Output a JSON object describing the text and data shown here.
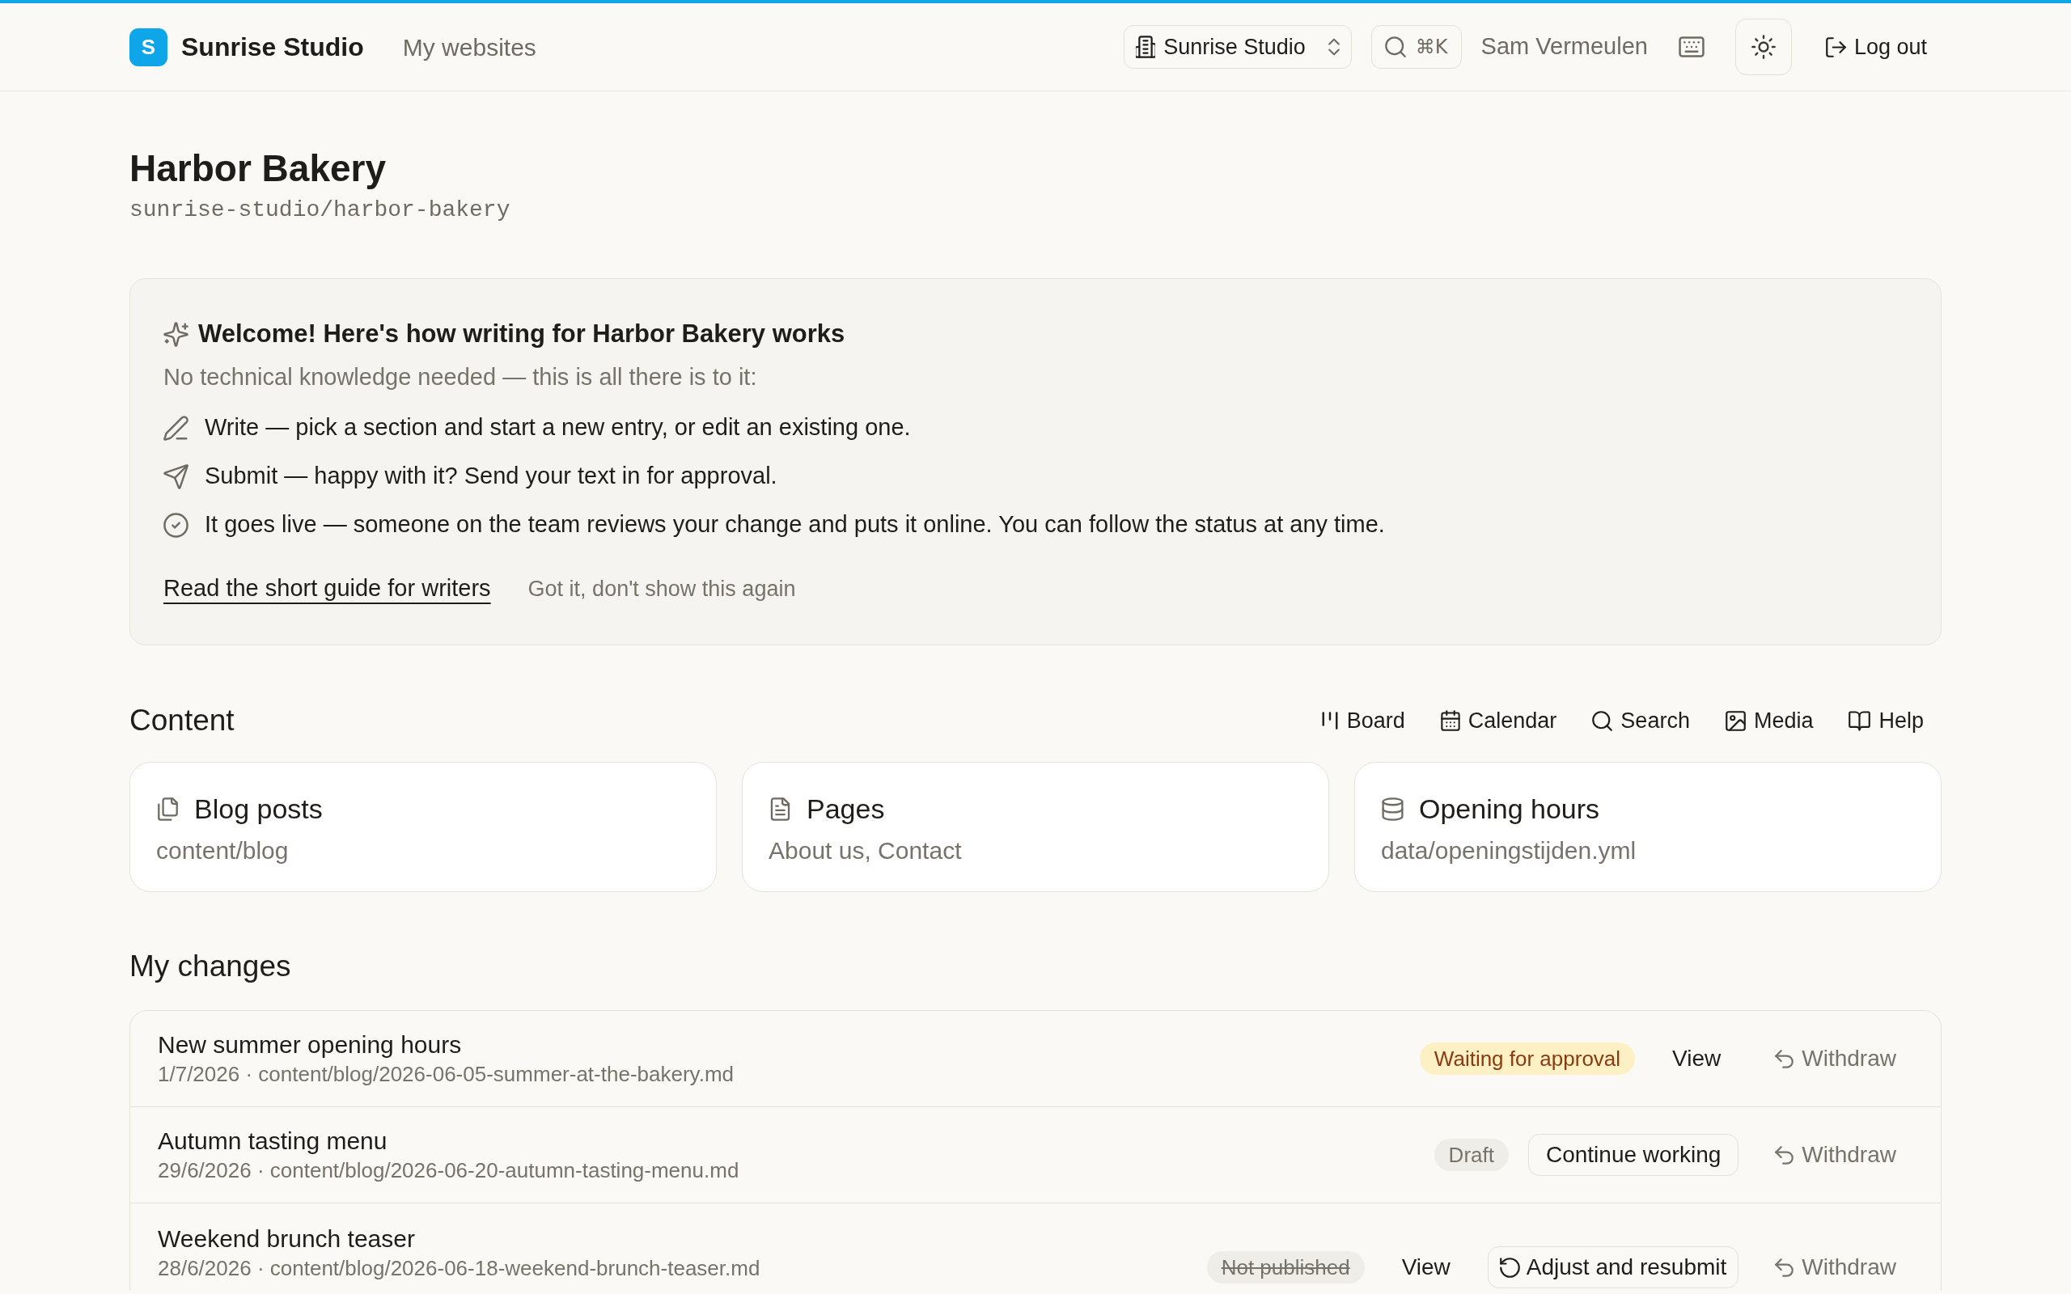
{
  "header": {
    "logo_letter": "S",
    "brand_name": "Sunrise Studio",
    "nav_link": "My websites",
    "workspace_switcher": "Sunrise Studio",
    "search_shortcut": "⌘K",
    "user_name": "Sam Vermeulen",
    "logout_label": "Log out"
  },
  "site": {
    "title": "Harbor Bakery",
    "path": "sunrise-studio/harbor-bakery"
  },
  "welcome": {
    "title": "Welcome! Here's how writing for Harbor Bakery works",
    "intro": "No technical knowledge needed — this is all there is to it:",
    "steps": [
      {
        "kind": "write",
        "text": "Write — pick a section and start a new entry, or edit an existing one."
      },
      {
        "kind": "submit",
        "text": "Submit — happy with it? Send your text in for approval."
      },
      {
        "kind": "publish",
        "text": "It goes live — someone on the team reviews your change and puts it online. You can follow the status at any time."
      }
    ],
    "guide_link": "Read the short guide for writers",
    "dismiss_link": "Got it, don't show this again"
  },
  "content": {
    "heading": "Content",
    "tools": [
      {
        "kind": "board",
        "label": "Board"
      },
      {
        "kind": "calendar",
        "label": "Calendar"
      },
      {
        "kind": "search",
        "label": "Search"
      },
      {
        "kind": "media",
        "label": "Media"
      },
      {
        "kind": "help",
        "label": "Help"
      }
    ],
    "sections": [
      {
        "kind": "posts",
        "name": "Blog posts",
        "detail": "content/blog"
      },
      {
        "kind": "pages",
        "name": "Pages",
        "detail": "About us, Contact"
      },
      {
        "kind": "data",
        "name": "Opening hours",
        "detail": "data/openingstijden.yml"
      }
    ]
  },
  "my_changes": {
    "heading": "My changes",
    "items": [
      {
        "title": "New summer opening hours",
        "meta": "1/7/2026 · content/blog/2026-06-05-summer-at-the-bakery.md",
        "status": {
          "kind": "pending",
          "label": "Waiting for approval"
        },
        "actions": [
          {
            "kind": "view",
            "label": "View"
          },
          {
            "kind": "withdraw",
            "label": "Withdraw"
          }
        ]
      },
      {
        "title": "Autumn tasting menu",
        "meta": "29/6/2026 · content/blog/2026-06-20-autumn-tasting-menu.md",
        "status": {
          "kind": "draft",
          "label": "Draft"
        },
        "actions": [
          {
            "kind": "continue",
            "label": "Continue working"
          },
          {
            "kind": "withdraw",
            "label": "Withdraw"
          }
        ]
      },
      {
        "title": "Weekend brunch teaser",
        "meta": "28/6/2026 · content/blog/2026-06-18-weekend-brunch-teaser.md",
        "status": {
          "kind": "rejected",
          "label": "Not published"
        },
        "actions": [
          {
            "kind": "view",
            "label": "View"
          },
          {
            "kind": "resubmit",
            "label": "Adjust and resubmit"
          },
          {
            "kind": "withdraw",
            "label": "Withdraw"
          }
        ]
      }
    ]
  }
}
